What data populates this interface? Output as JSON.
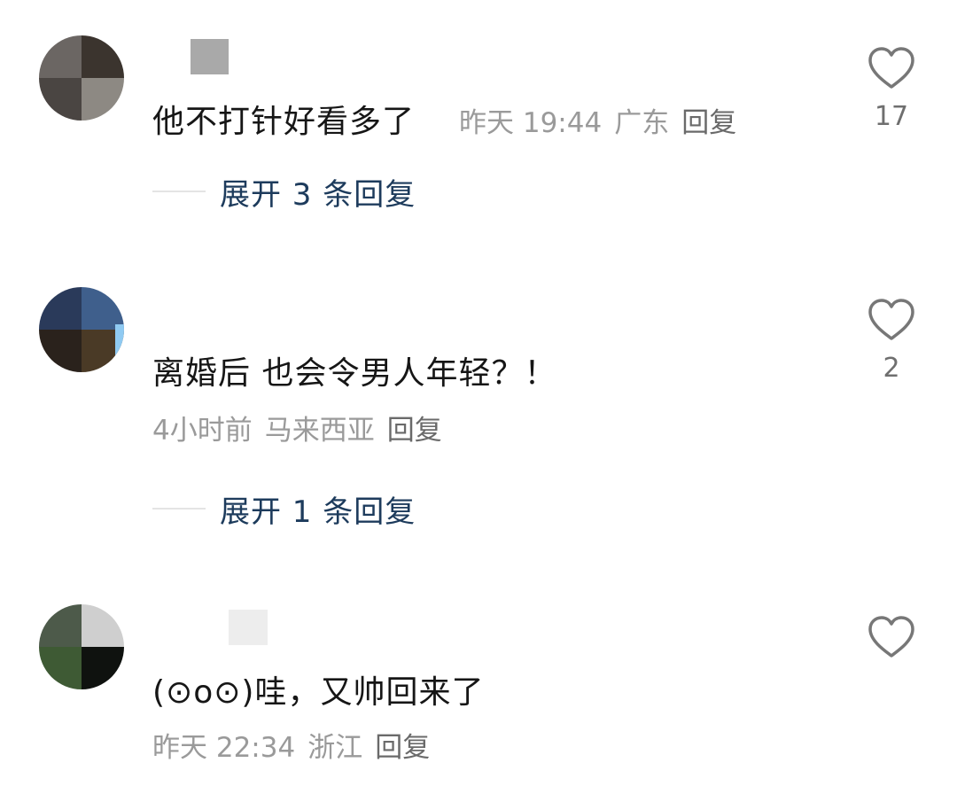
{
  "comments": [
    {
      "text": "他不打针好看多了",
      "time": "昨天 19:44",
      "location": "广东",
      "reply_label": "回复",
      "likes": "17",
      "expand_label": "展开 3 条回复"
    },
    {
      "text": "离婚后 也会令男人年轻？！",
      "time": "4小时前",
      "location": "马来西亚",
      "reply_label": "回复",
      "likes": "2",
      "expand_label": "展开 1 条回复"
    },
    {
      "text": "(⊙o⊙)哇，又帅回来了",
      "time": "昨天 22:34",
      "location": "浙江",
      "reply_label": "回复",
      "likes": "",
      "expand_label": ""
    }
  ],
  "icons": {
    "like": "heart-outline-icon",
    "like_color": "#777777"
  }
}
